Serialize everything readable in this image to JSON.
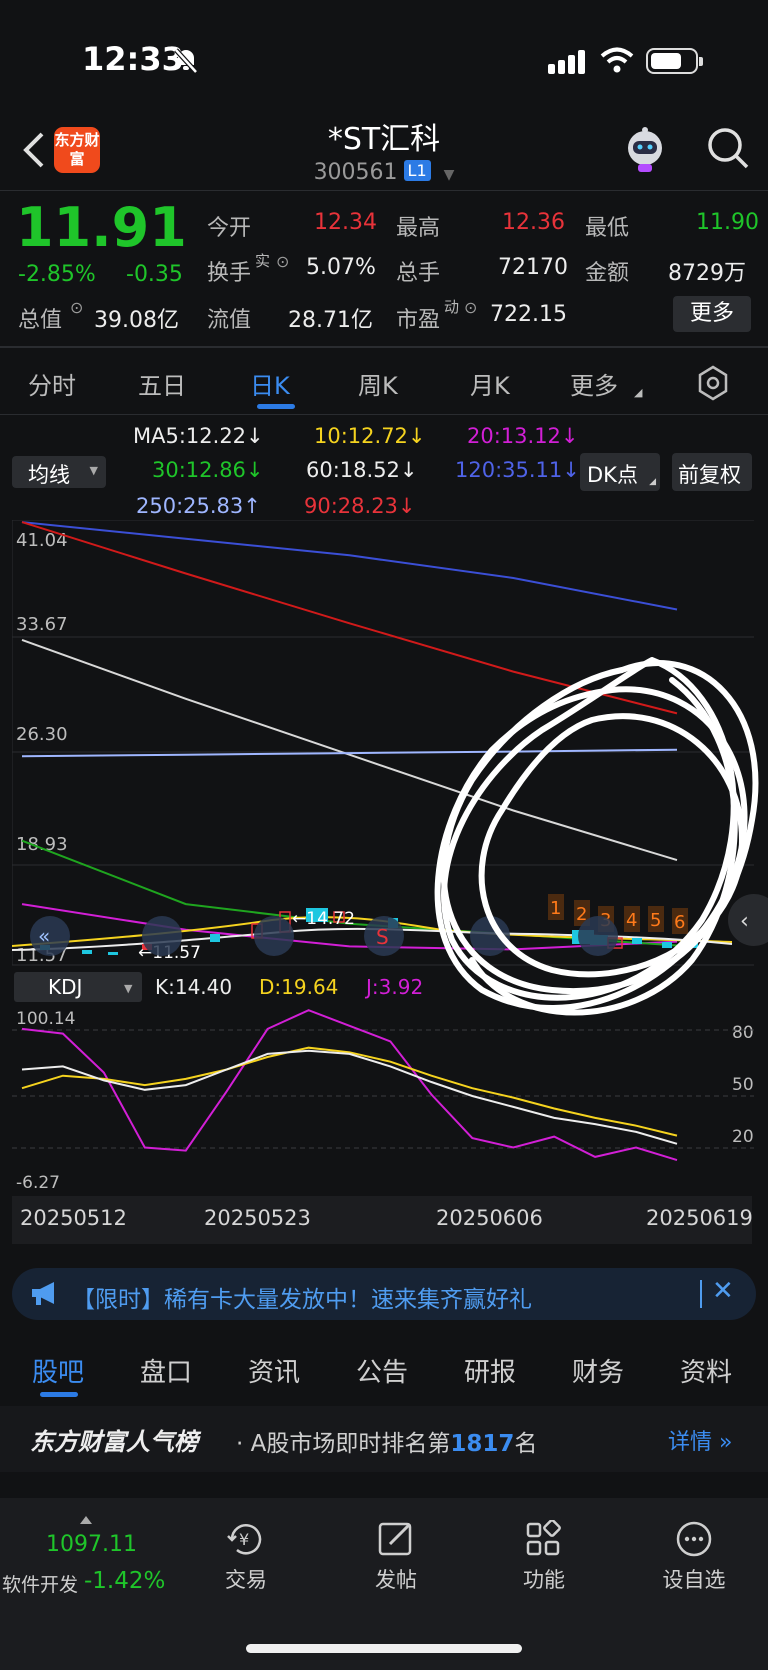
{
  "status_bar": {
    "time": "12:33"
  },
  "header": {
    "stock_name": "*ST汇科",
    "stock_code": "300561",
    "level": "L1",
    "logo_text": "东方财富"
  },
  "quote": {
    "price": "11.91",
    "change_pct": "-2.85%",
    "change": "-0.35",
    "open_label": "今开",
    "open": "12.34",
    "high_label": "最高",
    "high": "12.36",
    "low_label": "最低",
    "low": "11.90",
    "turnover_label": "换手",
    "turnover_sup": "实",
    "turnover": "5.07%",
    "volume_label": "总手",
    "volume": "72170",
    "amount_label": "金额",
    "amount": "8729万",
    "mktcap_label": "总值",
    "mktcap": "39.08亿",
    "float_label": "流值",
    "float_cap": "28.71亿",
    "pe_label": "市盈",
    "pe_sup": "动",
    "pe": "722.15",
    "more": "更多"
  },
  "period_tabs": [
    "分时",
    "五日",
    "日K",
    "周K",
    "月K",
    "更多"
  ],
  "ma_legend": {
    "indicator": "均线",
    "ma5": "MA5:12.22",
    "ma10": "10:12.72",
    "ma20": "20:13.12",
    "ma30": "30:12.86",
    "ma60": "60:18.52",
    "ma120": "120:35.11",
    "ma250": "250:25.83",
    "ma90": "90:28.23",
    "dk_button": "DK点",
    "adjust_button": "前复权"
  },
  "price_axis": [
    "41.04",
    "33.67",
    "26.30",
    "18.93",
    "11.57"
  ],
  "chart_annotations": {
    "high_label": "14.72",
    "low_label": "11.57",
    "markers": [
      "1",
      "2",
      "3",
      "4",
      "5",
      "6"
    ]
  },
  "kdj": {
    "indicator": "KDJ",
    "k": "K:14.40",
    "d": "D:19.64",
    "j": "J:3.92",
    "axis_top": "100.14",
    "axis_bottom": "-6.27",
    "right_ticks": [
      "80",
      "50",
      "20"
    ]
  },
  "dates": [
    "20250512",
    "20250523",
    "20250606",
    "20250619"
  ],
  "colors": {
    "up": "#e8333a",
    "down": "#1fc52a",
    "accent": "#2c7be5"
  },
  "chart_data": {
    "type": "line",
    "price_chart": {
      "ylim": [
        11.57,
        41.04
      ],
      "y_ticks": [
        41.04,
        33.67,
        26.3,
        18.93,
        11.57
      ],
      "series": [
        {
          "name": "MA5",
          "last": 12.22,
          "color": "#ffffff"
        },
        {
          "name": "10",
          "last": 12.72,
          "color": "#f5d31f"
        },
        {
          "name": "20",
          "last": 13.12,
          "color": "#d21fd6"
        },
        {
          "name": "30",
          "last": 12.86,
          "color": "#1fa51f"
        },
        {
          "name": "60",
          "last": 18.52,
          "color": "#d8d8d8"
        },
        {
          "name": "120",
          "last": 35.11,
          "color": "#3b4fd6"
        },
        {
          "name": "250",
          "last": 25.83,
          "color": "#9fb6ff"
        },
        {
          "name": "90",
          "last": 28.23,
          "color": "#d11a1a"
        }
      ],
      "series_points": {
        "120": [
          [
            0,
            40.9
          ],
          [
            1,
            39.8
          ],
          [
            2,
            38.7
          ],
          [
            3,
            37.2
          ],
          [
            4,
            35.11
          ]
        ],
        "90": [
          [
            0,
            40.9
          ],
          [
            1,
            37.5
          ],
          [
            2,
            34.2
          ],
          [
            3,
            31.0
          ],
          [
            4,
            28.23
          ]
        ],
        "60": [
          [
            0,
            33.1
          ],
          [
            1,
            29.2
          ],
          [
            2,
            25.5
          ],
          [
            3,
            21.8
          ],
          [
            4,
            18.52
          ]
        ],
        "250": [
          [
            0,
            25.4
          ],
          [
            1,
            25.5
          ],
          [
            2,
            25.6
          ],
          [
            3,
            25.7
          ],
          [
            4,
            25.83
          ]
        ],
        "30": [
          [
            0,
            19.8
          ],
          [
            1,
            15.6
          ],
          [
            2,
            14.3
          ],
          [
            3,
            13.6
          ],
          [
            4,
            12.86
          ]
        ],
        "20": [
          [
            0,
            15.6
          ],
          [
            1,
            13.9
          ],
          [
            2,
            12.8
          ],
          [
            3,
            12.6
          ],
          [
            4,
            13.12
          ]
        ]
      }
    },
    "kdj_chart": {
      "ylim": [
        -6.27,
        100.14
      ],
      "K": [
        62,
        64,
        55,
        49,
        52,
        62,
        72,
        74,
        72,
        64,
        54,
        45,
        38,
        31,
        27,
        22,
        14.4
      ],
      "D": [
        50,
        58,
        56,
        52,
        56,
        62,
        70,
        76,
        73,
        67,
        58,
        50,
        44,
        37,
        31,
        26,
        19.64
      ],
      "J": [
        88,
        85,
        60,
        12,
        10,
        48,
        88,
        100,
        90,
        80,
        46,
        18,
        12,
        19,
        6,
        12,
        3.92
      ]
    }
  },
  "promo": {
    "text": "【限时】稀有卡大量发放中！速来集齐赢好礼"
  },
  "info_tabs": [
    "股吧",
    "盘口",
    "资讯",
    "公告",
    "研报",
    "财务",
    "资料"
  ],
  "ranking": {
    "brand": "东方财富人气榜",
    "text_prefix": "· A股市场即时排名第",
    "rank": "1817",
    "suffix": "名",
    "detail": "详情"
  },
  "bottom_nav": {
    "index_value": "1097.11",
    "index_name": "软件开发",
    "index_pct": "-1.42%",
    "items": [
      "交易",
      "发帖",
      "功能",
      "设自选"
    ]
  }
}
